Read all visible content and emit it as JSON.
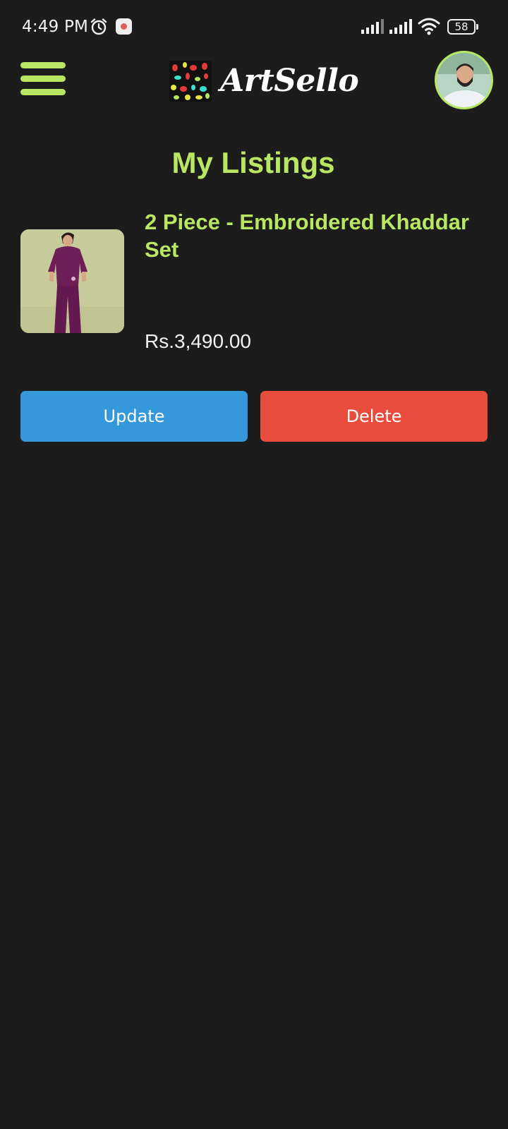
{
  "status_bar": {
    "time": "4:49 PM",
    "battery": "58",
    "icons": [
      "alarm-icon",
      "notification-icon",
      "signal-icon",
      "signal-icon",
      "wifi-icon",
      "battery-icon"
    ]
  },
  "header": {
    "app_name": "ArtSello",
    "menu_icon": "hamburger-menu-icon",
    "accent_color": "#b9e763"
  },
  "page": {
    "title": "My Listings"
  },
  "listings": [
    {
      "name": "2 Piece - Embroidered Khaddar Set",
      "price": "Rs.3,490.00",
      "update_label": "Update",
      "delete_label": "Delete"
    }
  ],
  "colors": {
    "background": "#1c1c1c",
    "update": "#3498db",
    "delete": "#e74c3c",
    "accent": "#b9e763"
  }
}
